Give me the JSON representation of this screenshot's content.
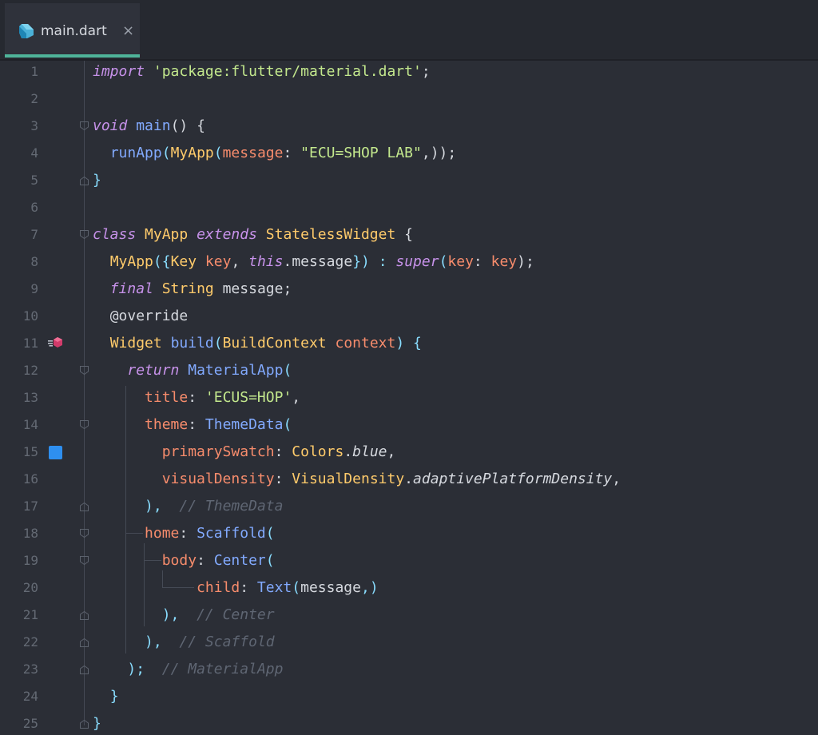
{
  "tab": {
    "label": "main.dart",
    "close": "×",
    "icon": "dart-file-icon"
  },
  "colors": {
    "accent": "#4fb49a",
    "swatch_primary": "#2e8ff0"
  },
  "lines": [
    {
      "n": "1"
    },
    {
      "n": "2"
    },
    {
      "n": "3"
    },
    {
      "n": "4"
    },
    {
      "n": "5"
    },
    {
      "n": "6"
    },
    {
      "n": "7"
    },
    {
      "n": "8"
    },
    {
      "n": "9"
    },
    {
      "n": "10"
    },
    {
      "n": "11"
    },
    {
      "n": "12"
    },
    {
      "n": "13"
    },
    {
      "n": "14"
    },
    {
      "n": "15"
    },
    {
      "n": "16"
    },
    {
      "n": "17"
    },
    {
      "n": "18"
    },
    {
      "n": "19"
    },
    {
      "n": "20"
    },
    {
      "n": "21"
    },
    {
      "n": "22"
    },
    {
      "n": "23"
    },
    {
      "n": "24"
    },
    {
      "n": "25"
    }
  ],
  "code": {
    "l1": {
      "kw": "import",
      "str": "'package:flutter/material.dart'",
      "end": ";"
    },
    "l3": {
      "kw": "void",
      "fn": "main",
      "rest": "() {"
    },
    "l4": {
      "fn": "runApp",
      "cls": "MyApp",
      "param": "message",
      "str": "\"ECU=SHOP LAB\"",
      "end": ",));"
    },
    "l5": {
      "text": "}"
    },
    "l7": {
      "kw1": "class",
      "cls1": "MyApp",
      "kw2": "extends",
      "cls2": "StatelessWidget",
      "end": " {"
    },
    "l8": {
      "cls": "MyApp",
      "open": "({",
      "cls2": "Key",
      "p1": "key",
      "comma": ", ",
      "kw": "this",
      "dot": ".",
      "m": "message",
      "close": "}) : ",
      "sup": "super",
      "o2": "(",
      "p2": "key",
      "colon": ": ",
      "p3": "key",
      "end": ");"
    },
    "l9": {
      "kw": "final",
      "cls": "String",
      "rest": "message;"
    },
    "l10": {
      "text": "@override"
    },
    "l11": {
      "cls": "Widget",
      "fn": "build",
      "o": "(",
      "cls2": "BuildContext",
      "p": "context",
      "end": ") {"
    },
    "l12": {
      "kw": "return",
      "fn": "MaterialApp",
      "end": "("
    },
    "l13": {
      "param": "title",
      "colon": ": ",
      "str": "'ECUS=HOP'",
      "end": ","
    },
    "l14": {
      "param": "theme",
      "colon": ": ",
      "fn": "ThemeData",
      "end": "("
    },
    "l15": {
      "param": "primarySwatch",
      "colon": ": ",
      "cls": "Colors",
      "dot": ".",
      "it": "blue",
      "end": ","
    },
    "l16": {
      "param": "visualDensity",
      "colon": ": ",
      "cls": "VisualDensity",
      "dot": ".",
      "it": "adaptivePlatformDensity",
      "end": ","
    },
    "l17": {
      "text": "),",
      "cm": "// ThemeData"
    },
    "l18": {
      "param": "home",
      "colon": ": ",
      "fn": "Scaffold",
      "end": "("
    },
    "l19": {
      "param": "body",
      "colon": ": ",
      "fn": "Center",
      "end": "("
    },
    "l20": {
      "param": "child",
      "colon": ": ",
      "fn": "Text",
      "o": "(",
      "m": "message",
      "end": ",)"
    },
    "l21": {
      "text": "),",
      "cm": "// Center"
    },
    "l22": {
      "text": "),",
      "cm": "// Scaffold"
    },
    "l23": {
      "text": ");",
      "cm": "// MaterialApp"
    },
    "l24": {
      "text": "}"
    },
    "l25": {
      "text": "}"
    }
  },
  "gutter_icons": {
    "override": "override-method-icon",
    "swatch": "color-swatch-icon"
  }
}
